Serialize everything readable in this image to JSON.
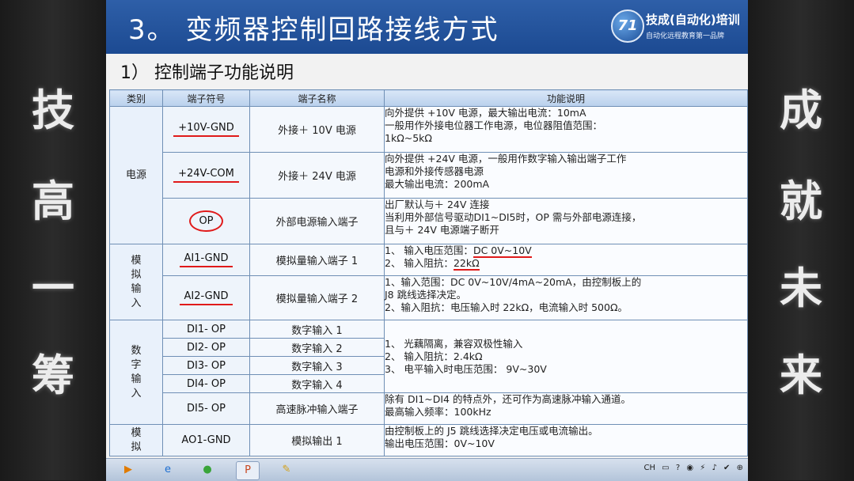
{
  "side_left": [
    "技",
    "高",
    "一",
    "筹"
  ],
  "side_right": [
    "成",
    "就",
    "未",
    "来"
  ],
  "header": {
    "title": "3。 变频器控制回路接线方式",
    "logo_mark": "71",
    "logo_name": "技成(自动化)培训",
    "logo_slogan": "自动化远程教育第一品牌"
  },
  "subtitle": "1） 控制端子功能说明",
  "table": {
    "headers": [
      "类别",
      "端子符号",
      "端子名称",
      "功能说明"
    ],
    "categories": {
      "power": "电源",
      "analog_in": "模\n拟\n输\n入",
      "digital_in": "数\n字\n输\n入",
      "analog_out": "模\n拟"
    },
    "rows": {
      "r1": {
        "symbol": "+10V-GND",
        "name": "外接＋ 10V 电源",
        "desc": [
          "向外提供 +10V 电源，最大输出电流：10mA",
          "一般用作外接电位器工作电源，电位器阻值范围：",
          "1kΩ~5kΩ"
        ]
      },
      "r2": {
        "symbol": "+24V-COM",
        "name": "外接＋ 24V 电源",
        "desc": [
          "向外提供 +24V 电源，一般用作数字输入输出端子工作",
          "电源和外接传感器电源",
          "最大输出电流：200mA"
        ]
      },
      "r3": {
        "symbol": "OP",
        "name": "外部电源输入端子",
        "desc": [
          "出厂默认与＋ 24V 连接",
          "当利用外部信号驱动DI1~DI5时，OP 需与外部电源连接，",
          "且与＋ 24V 电源端子断开"
        ]
      },
      "r4": {
        "symbol": "AI1-GND",
        "name": "模拟量输入端子 1",
        "desc1": "1、 输入电压范围：",
        "desc1_value": "DC 0V~10V",
        "desc2": "2、 输入阻抗：",
        "desc2_value": "22kΩ"
      },
      "r5": {
        "symbol": "AI2-GND",
        "name": "模拟量输入端子 2",
        "desc": [
          "1、输入范围：DC 0V~10V/4mA~20mA，由控制板上的",
          "J8 跳线选择决定。",
          "2、输入阻抗：电压输入时 22kΩ，电流输入时 500Ω。"
        ]
      },
      "r6": {
        "symbol": "DI1- OP",
        "name": "数字输入 1"
      },
      "r7": {
        "symbol": "DI2- OP",
        "name": "数字输入 2"
      },
      "r8": {
        "symbol": "DI3- OP",
        "name": "数字输入 3"
      },
      "r9": {
        "symbol": "DI4- OP",
        "name": "数字输入 4"
      },
      "di_desc": [
        "1、 光藕隔离，兼容双极性输入",
        "2、 输入阻抗：2.4kΩ",
        "3、 电平输入时电压范围： 9V~30V"
      ],
      "r10": {
        "symbol": "DI5- OP",
        "name": "高速脉冲输入端子",
        "desc": [
          "除有 DI1~DI4 的特点外，还可作为高速脉冲输入通道。",
          "最高输入频率：100kHz"
        ]
      },
      "r11": {
        "symbol": "AO1-GND",
        "name": "模拟输出 1",
        "desc": [
          "由控制板上的 J5 跳线选择决定电压或电流输出。",
          "输出电压范围：0V~10V"
        ]
      }
    }
  },
  "taskbar": {
    "buttons": [
      {
        "icon": "media-player-icon",
        "glyph": "▶",
        "color": "#e07b00"
      },
      {
        "icon": "ie-browser-icon",
        "glyph": "e",
        "color": "#1e6fd1"
      },
      {
        "icon": "green-app-icon",
        "glyph": "●",
        "color": "#3aa53a"
      },
      {
        "icon": "powerpoint-icon",
        "glyph": "P",
        "color": "#c8461f"
      },
      {
        "icon": "pen-icon",
        "glyph": "✎",
        "color": "#d4a017"
      }
    ],
    "tray": [
      "CH",
      "▭",
      "?",
      "◉",
      "⚡",
      "♪",
      "✔",
      "⊕"
    ]
  },
  "colors": {
    "header_blue": "#1c4a92",
    "annotation_red": "#e01a1a",
    "table_border": "#6f8fb5"
  }
}
